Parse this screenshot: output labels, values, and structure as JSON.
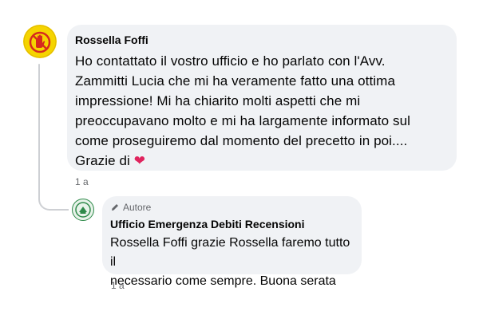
{
  "comment": {
    "author": "Rossella Foffi",
    "lines": [
      "Ho contattato il vostro ufficio e ho parlato con l'Avv.",
      "Zammitti Lucia che mi ha veramente fatto una ottima",
      "impressione! Mi ha chiarito molti aspetti che mi",
      "preoccupavano molto e mi ha largamente informato sul",
      "come proseguiremo dal momento del precetto in poi...."
    ],
    "last_line_text": "Grazie di",
    "heart": "❤",
    "time": "1 a",
    "avatar_icon": "stop-hand-logo-icon",
    "avatar_color": "#f5d400"
  },
  "reply": {
    "badge_label": "Autore",
    "badge_icon": "pencil-icon",
    "author": "Ufficio Emergenza Debiti Recensioni",
    "lines": [
      "Rossella Foffi grazie Rossella faremo tutto il",
      "necessario come sempre. Buona serata"
    ],
    "time": "1 a",
    "avatar_icon": "office-logo-icon",
    "avatar_color": "#2f8a4a"
  }
}
